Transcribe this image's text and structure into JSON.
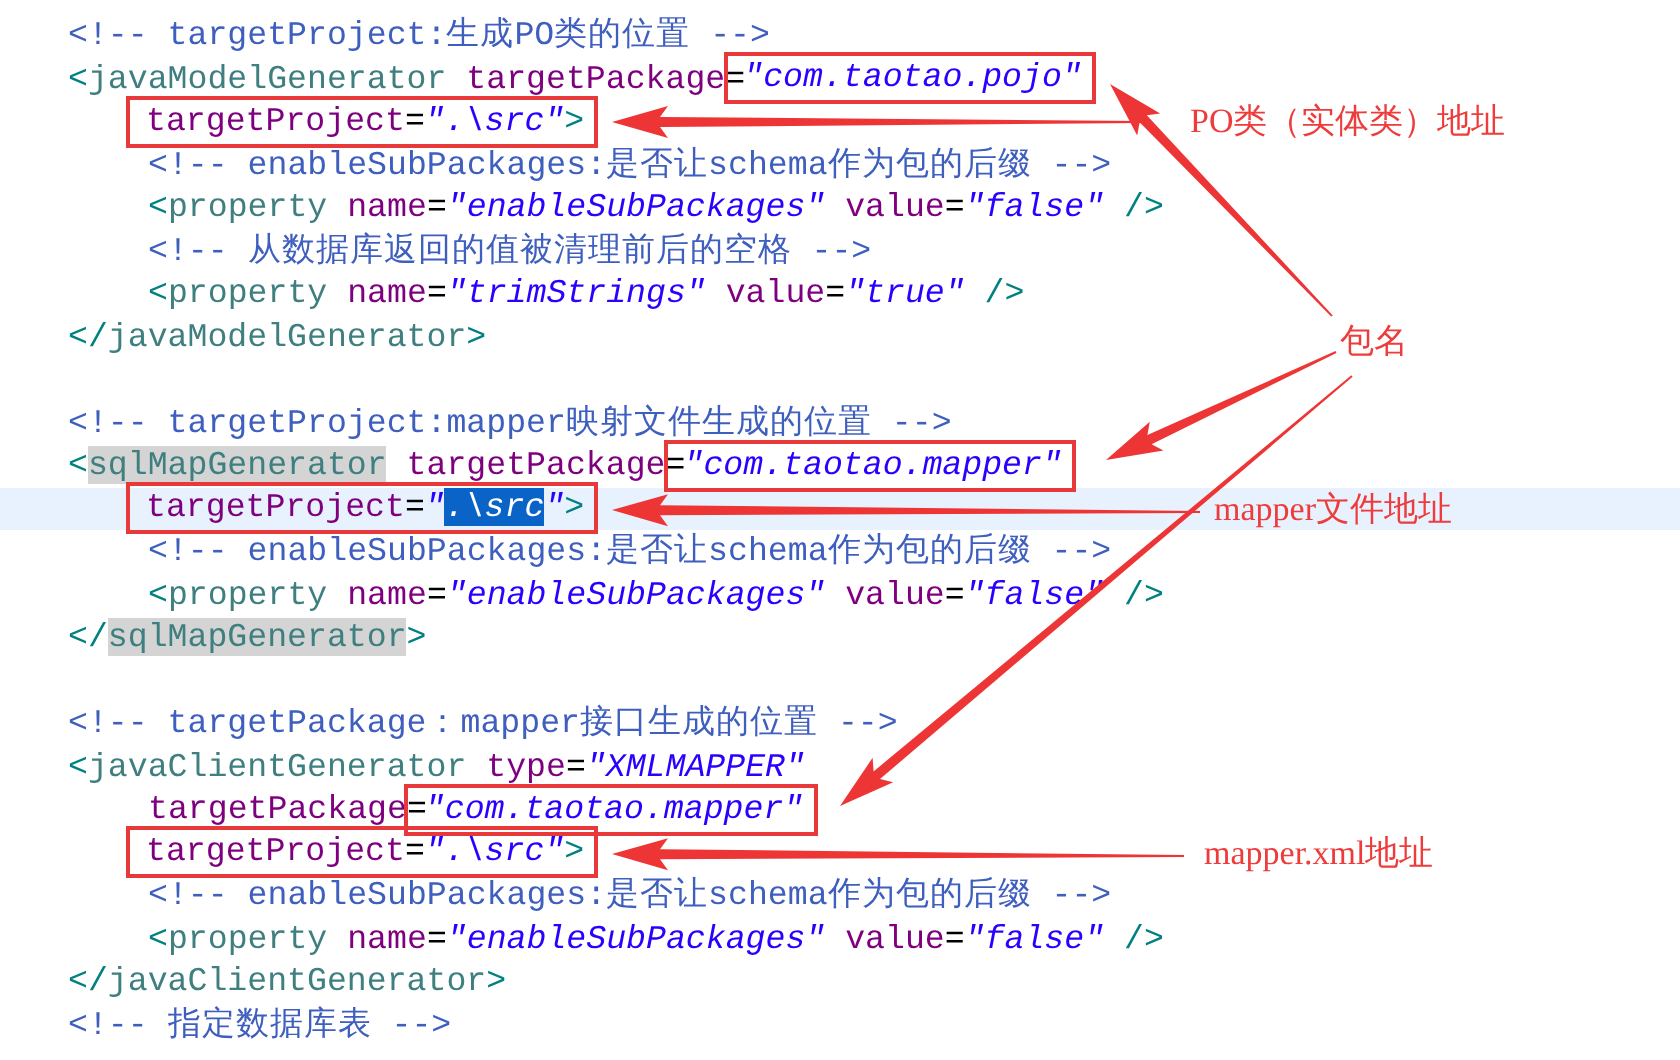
{
  "lines": [
    {
      "indented": false,
      "current": false,
      "segments": [
        {
          "boxed": false,
          "tokens": [
            {
              "kind": "comment",
              "text": "<!-- targetProject:生成PO类的位置 -->"
            }
          ]
        }
      ]
    },
    {
      "indented": false,
      "current": false,
      "segments": [
        {
          "boxed": false,
          "tokens": [
            {
              "kind": "punct",
              "text": "<"
            },
            {
              "kind": "tag",
              "text": "javaModelGenerator"
            },
            {
              "kind": "attr",
              "text": " targetPackage"
            },
            {
              "kind": "equals",
              "text": "="
            }
          ]
        },
        {
          "boxed": true,
          "tokens": [
            {
              "kind": "string",
              "text": "\"com.taotao.pojo\""
            }
          ]
        }
      ]
    },
    {
      "indented": true,
      "current": false,
      "segments": [
        {
          "boxed": true,
          "tokens": [
            {
              "kind": "attr",
              "text": "targetProject"
            },
            {
              "kind": "equals",
              "text": "="
            },
            {
              "kind": "string",
              "text": "\".\\src\""
            },
            {
              "kind": "punct",
              "text": ">"
            }
          ]
        }
      ]
    },
    {
      "indented": true,
      "current": false,
      "segments": [
        {
          "boxed": false,
          "tokens": [
            {
              "kind": "comment",
              "text": "<!-- enableSubPackages:是否让schema作为包的后缀 -->"
            }
          ]
        }
      ]
    },
    {
      "indented": true,
      "current": false,
      "segments": [
        {
          "boxed": false,
          "tokens": [
            {
              "kind": "punct",
              "text": "<"
            },
            {
              "kind": "tag",
              "text": "property"
            },
            {
              "kind": "attr",
              "text": " name"
            },
            {
              "kind": "equals",
              "text": "="
            },
            {
              "kind": "string",
              "text": "\"enableSubPackages\""
            },
            {
              "kind": "attr",
              "text": " value"
            },
            {
              "kind": "equals",
              "text": "="
            },
            {
              "kind": "string",
              "text": "\"false\""
            },
            {
              "kind": "punct",
              "text": " />"
            }
          ]
        }
      ]
    },
    {
      "indented": true,
      "current": false,
      "segments": [
        {
          "boxed": false,
          "tokens": [
            {
              "kind": "comment",
              "text": "<!-- 从数据库返回的值被清理前后的空格 -->"
            }
          ]
        }
      ]
    },
    {
      "indented": true,
      "current": false,
      "segments": [
        {
          "boxed": false,
          "tokens": [
            {
              "kind": "punct",
              "text": "<"
            },
            {
              "kind": "tag",
              "text": "property"
            },
            {
              "kind": "attr",
              "text": " name"
            },
            {
              "kind": "equals",
              "text": "="
            },
            {
              "kind": "string",
              "text": "\"trimStrings\""
            },
            {
              "kind": "attr",
              "text": " value"
            },
            {
              "kind": "equals",
              "text": "="
            },
            {
              "kind": "string",
              "text": "\"true\""
            },
            {
              "kind": "punct",
              "text": " />"
            }
          ]
        }
      ]
    },
    {
      "indented": false,
      "current": false,
      "segments": [
        {
          "boxed": false,
          "tokens": [
            {
              "kind": "punct",
              "text": "</"
            },
            {
              "kind": "tag",
              "text": "javaModelGenerator"
            },
            {
              "kind": "punct",
              "text": ">"
            }
          ]
        }
      ]
    },
    {
      "current": false
    },
    {
      "indented": false,
      "current": false,
      "segments": [
        {
          "boxed": false,
          "tokens": [
            {
              "kind": "comment",
              "text": "<!-- targetProject:mapper映射文件生成的位置 -->"
            }
          ]
        }
      ]
    },
    {
      "indented": false,
      "current": false,
      "segments": [
        {
          "boxed": false,
          "tokens": [
            {
              "kind": "punct",
              "text": "<"
            },
            {
              "kind": "tag",
              "text": "sqlMapGenerator",
              "highlighted": true
            },
            {
              "kind": "attr",
              "text": " targetPackage"
            },
            {
              "kind": "equals",
              "text": "="
            }
          ]
        },
        {
          "boxed": true,
          "tokens": [
            {
              "kind": "string",
              "text": "\"com.taotao.mapper\""
            }
          ]
        }
      ]
    },
    {
      "indented": true,
      "current": true,
      "segments": [
        {
          "boxed": true,
          "tokens": [
            {
              "kind": "attr",
              "text": "targetProject"
            },
            {
              "kind": "equals",
              "text": "="
            },
            {
              "kind": "string",
              "text": "\""
            },
            {
              "kind": "string",
              "text": ".\\src",
              "selected": true
            },
            {
              "kind": "string",
              "text": "\""
            },
            {
              "kind": "punct",
              "text": ">"
            }
          ]
        }
      ]
    },
    {
      "indented": true,
      "current": false,
      "segments": [
        {
          "boxed": false,
          "tokens": [
            {
              "kind": "comment",
              "text": "<!-- enableSubPackages:是否让schema作为包的后缀 -->"
            }
          ]
        }
      ]
    },
    {
      "indented": true,
      "current": false,
      "segments": [
        {
          "boxed": false,
          "tokens": [
            {
              "kind": "punct",
              "text": "<"
            },
            {
              "kind": "tag",
              "text": "property"
            },
            {
              "kind": "attr",
              "text": " name"
            },
            {
              "kind": "equals",
              "text": "="
            },
            {
              "kind": "string",
              "text": "\"enableSubPackages\""
            },
            {
              "kind": "attr",
              "text": " value"
            },
            {
              "kind": "equals",
              "text": "="
            },
            {
              "kind": "string",
              "text": "\"false\""
            },
            {
              "kind": "punct",
              "text": " />"
            }
          ]
        }
      ]
    },
    {
      "indented": false,
      "current": false,
      "segments": [
        {
          "boxed": false,
          "tokens": [
            {
              "kind": "punct",
              "text": "</"
            },
            {
              "kind": "tag",
              "text": "sqlMapGenerator",
              "highlighted": true
            },
            {
              "kind": "punct",
              "text": ">"
            }
          ]
        }
      ]
    },
    {
      "current": false
    },
    {
      "indented": false,
      "current": false,
      "segments": [
        {
          "boxed": false,
          "tokens": [
            {
              "kind": "comment",
              "text": "<!-- targetPackage：mapper接口生成的位置 -->"
            }
          ]
        }
      ]
    },
    {
      "indented": false,
      "current": false,
      "segments": [
        {
          "boxed": false,
          "tokens": [
            {
              "kind": "punct",
              "text": "<"
            },
            {
              "kind": "tag",
              "text": "javaClientGenerator"
            },
            {
              "kind": "attr",
              "text": " type"
            },
            {
              "kind": "equals",
              "text": "="
            },
            {
              "kind": "string",
              "text": "\"XMLMAPPER\""
            }
          ]
        }
      ]
    },
    {
      "indented": true,
      "current": false,
      "segments": [
        {
          "boxed": false,
          "tokens": [
            {
              "kind": "attr",
              "text": "targetPackage"
            },
            {
              "kind": "equals",
              "text": "="
            }
          ]
        },
        {
          "boxed": true,
          "tokens": [
            {
              "kind": "string",
              "text": "\"com.taotao.mapper\""
            }
          ]
        }
      ]
    },
    {
      "indented": true,
      "current": false,
      "segments": [
        {
          "boxed": true,
          "tokens": [
            {
              "kind": "attr",
              "text": "targetProject"
            },
            {
              "kind": "equals",
              "text": "="
            },
            {
              "kind": "string",
              "text": "\".\\src\""
            },
            {
              "kind": "punct",
              "text": ">"
            }
          ]
        }
      ]
    },
    {
      "indented": true,
      "current": false,
      "segments": [
        {
          "boxed": false,
          "tokens": [
            {
              "kind": "comment",
              "text": "<!-- enableSubPackages:是否让schema作为包的后缀 -->"
            }
          ]
        }
      ]
    },
    {
      "indented": true,
      "current": false,
      "segments": [
        {
          "boxed": false,
          "tokens": [
            {
              "kind": "punct",
              "text": "<"
            },
            {
              "kind": "tag",
              "text": "property"
            },
            {
              "kind": "attr",
              "text": " name"
            },
            {
              "kind": "equals",
              "text": "="
            },
            {
              "kind": "string",
              "text": "\"enableSubPackages\""
            },
            {
              "kind": "attr",
              "text": " value"
            },
            {
              "kind": "equals",
              "text": "="
            },
            {
              "kind": "string",
              "text": "\"false\""
            },
            {
              "kind": "punct",
              "text": " />"
            }
          ]
        }
      ]
    },
    {
      "indented": false,
      "current": false,
      "segments": [
        {
          "boxed": false,
          "tokens": [
            {
              "kind": "punct",
              "text": "</"
            },
            {
              "kind": "tag",
              "text": "javaClientGenerator"
            },
            {
              "kind": "punct",
              "text": ">"
            }
          ]
        }
      ]
    },
    {
      "indented": false,
      "current": false,
      "segments": [
        {
          "boxed": false,
          "tokens": [
            {
              "kind": "comment",
              "text": "<!-- 指定数据库表 -->"
            }
          ]
        }
      ]
    }
  ],
  "annotations": [
    {
      "text": "PO类（实体类）地址"
    },
    {
      "text": "包名"
    },
    {
      "text": "mapper文件地址"
    },
    {
      "text": "mapper.xml地址"
    }
  ]
}
